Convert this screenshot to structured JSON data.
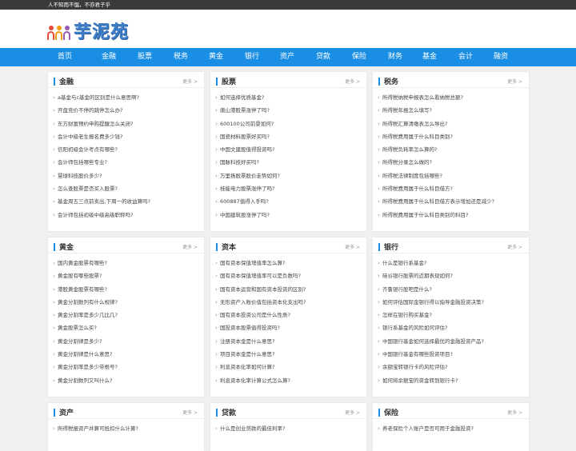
{
  "topbar": {
    "slogan": "人不知而不愠，不亦君子乎"
  },
  "logo": {
    "text": "芋泥苑",
    "colors": [
      "#e74c3c",
      "#f39c12",
      "#9b59b6"
    ]
  },
  "nav": [
    "首页",
    "金融",
    "股票",
    "税务",
    "黄金",
    "银行",
    "资产",
    "贷款",
    "保险",
    "财务",
    "基金",
    "会计",
    "融资"
  ],
  "more_label": "更多 >",
  "cards": [
    {
      "title": "金融",
      "items": [
        "a基金与c基金的区别是什么意思啊?",
        "开盘竞价不停的跳停怎么办?",
        "东方财富预约申购提醒怎么关闭?",
        "会计中级老生报名费多少钱?",
        "信阳初级会计考点有哪些?",
        "会计师包括哪些专业?",
        "慧球科技股价多少?",
        "怎么查股票是否买入股票?",
        "基金周五三点前卖出,下周一的收益算吗?",
        "会计师包括初级中级高级职称吗?"
      ]
    },
    {
      "title": "股票",
      "items": [
        "如何选择优质基金?",
        "唐山港股票涨停了吗?",
        "600100公司前景如何?",
        "国瓷材料股票好买吗?",
        "中国文建股值得投资吗?",
        "国脉科技好买吗?",
        "万里扬股票股价走势如何?",
        "桂能电力股票涨停了吗?",
        "600887值得入手吗?",
        "中国建筑股涨停了吗?"
      ]
    },
    {
      "title": "税务",
      "items": [
        "所得税纳税申报表怎么看纳税总额?",
        "所得税年报怎么填写?",
        "所得税汇算清缴表怎么导出?",
        "所得税费用属于什么科目类别?",
        "所得税负耗率怎么算的?",
        "所得税分录怎么做的?",
        "所得税法律制度包括哪些?",
        "所得税费用属于什么科目借方?",
        "所得税费用属于什么科目借方表示增加还是减少?",
        "所得税费用属于什么科目类别的科目?"
      ]
    },
    {
      "title": "黄金",
      "items": [
        "国内黄金股票有哪些?",
        "黄金股有哪些股票?",
        "港股黄金股票有哪些?",
        "黄金分割数列有什么规律?",
        "黄金分割率是多少几比几?",
        "黄金股票怎么买?",
        "黄金分割律是多少?",
        "黄金分割律是什么意思?",
        "黄金分割率是多少带根号?",
        "黄金分割数列又叫什么?"
      ]
    },
    {
      "title": "资本",
      "items": [
        "国有资本保值增值率怎么算?",
        "国有资本保值增值率可以是负数吗?",
        "国有资本运营和国有资本投资的区别?",
        "无形资产入账价值包括资本化支出吗?",
        "国有资本投资公司是什么性质?",
        "国投资本股票值得投资吗?",
        "注册资本金是什么意思?",
        "项目资本金是什么意思?",
        "利息资本化率如何计算?",
        "利息资本化率计算公式怎么算?",
        "利息资本化率是什么意思?"
      ]
    },
    {
      "title": "银行",
      "items": [
        "什么是银行系基金?",
        "硅谷银行股票的近期表现如何?",
        "齐鲁银行股吧是什么?",
        "如何评估国际金银行得以指导金融投资决策?",
        "怎样在银行购买基金?",
        "银行系基金的风险如何评估?",
        "中国银行基金如何选择最优的金融投资产品?",
        "中国银行基金有哪些投资项目?",
        "余额宝转银行卡的风险评估?",
        "如何将余额宝的资金转到银行卡?"
      ]
    },
    {
      "title": "资产",
      "items": [
        "所得税报资产并算可抵扣什么计算?"
      ]
    },
    {
      "title": "贷款",
      "items": [
        "什么是创业贷款的最佳利率?"
      ]
    },
    {
      "title": "保险",
      "items": [
        "养老保险个人账户是否可用于金融投资?"
      ]
    }
  ]
}
